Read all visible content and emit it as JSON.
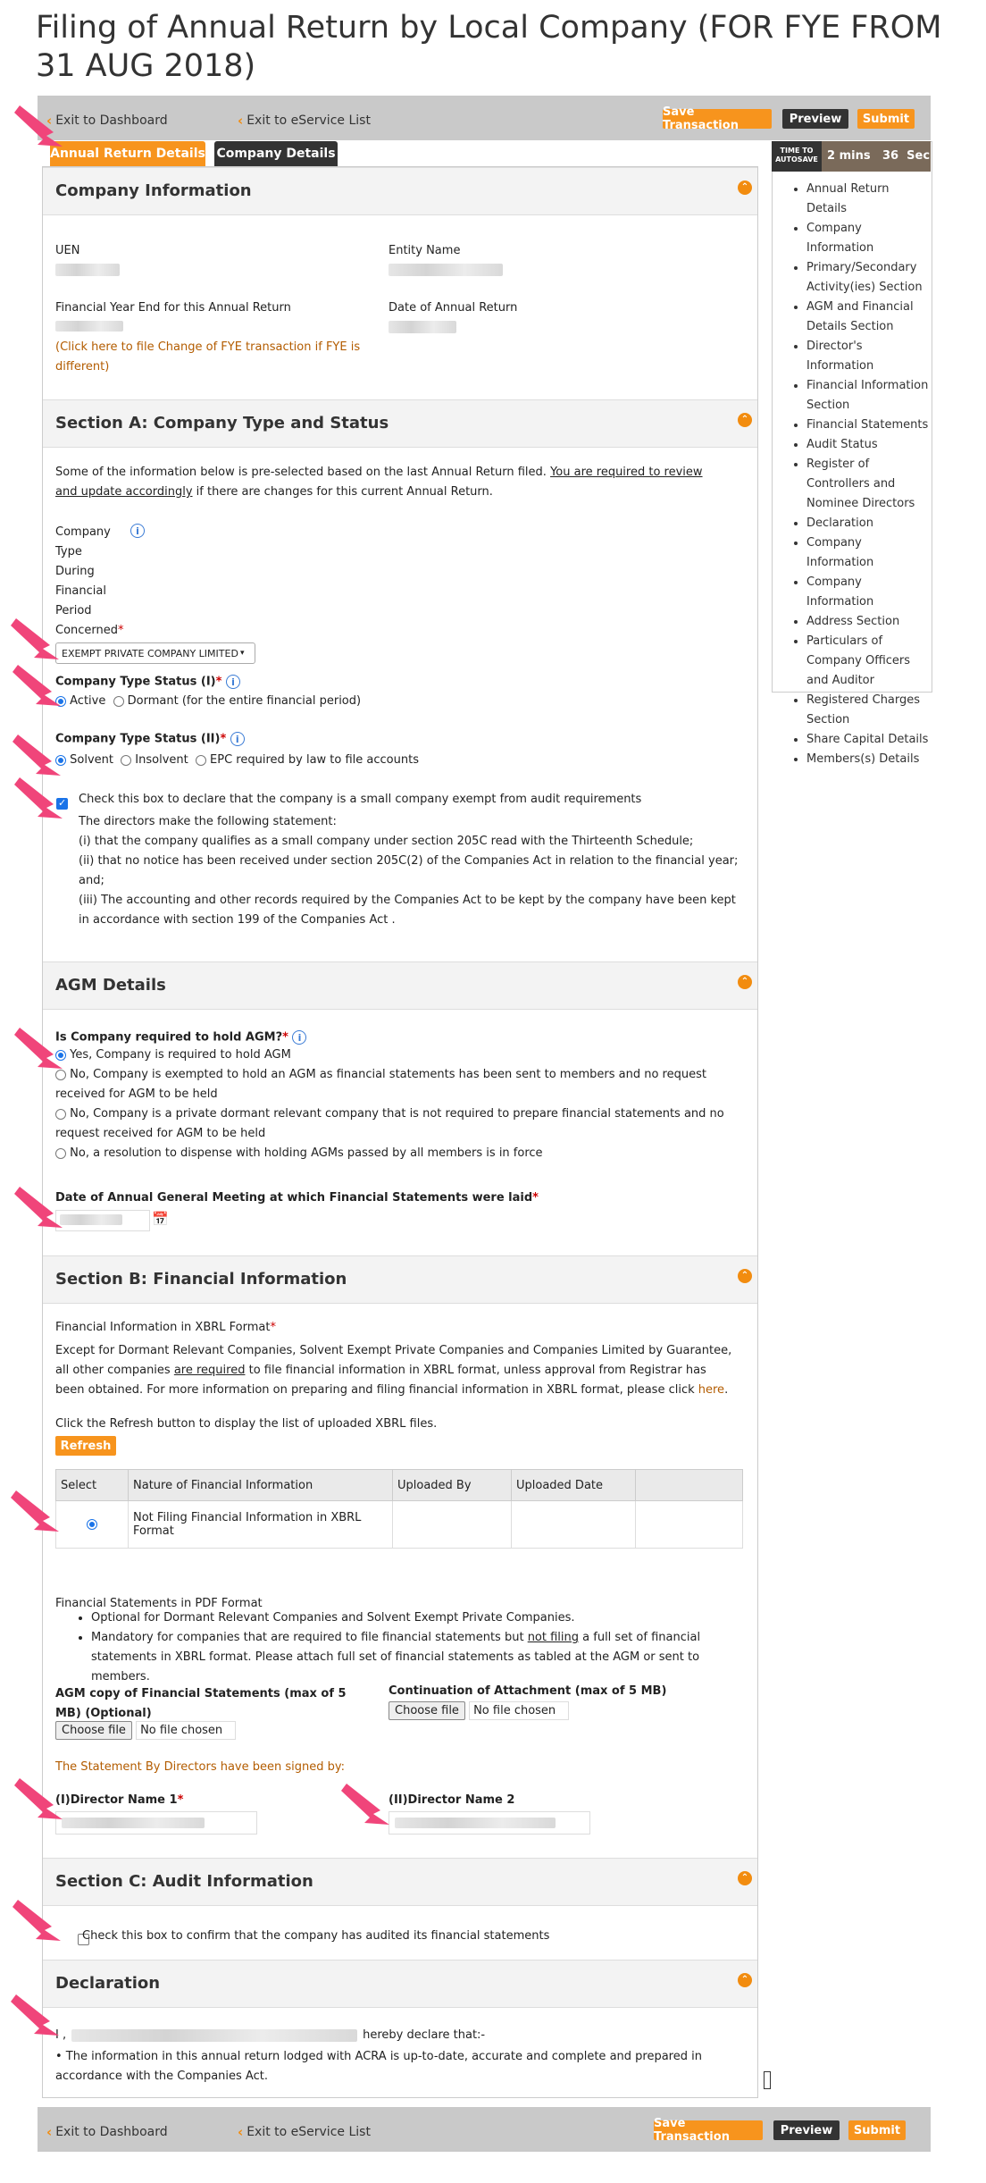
{
  "page_title": "Filing of Annual Return by Local Company (FOR FYE FROM 31 AUG 2018)",
  "toolbar": {
    "exit_dashboard": "Exit to Dashboard",
    "exit_eservice": "Exit to eService List",
    "save": "Save Transaction",
    "preview": "Preview",
    "submit": "Submit"
  },
  "tabs": [
    "Annual Return Details",
    "Company Details"
  ],
  "autosave": {
    "label": "TIME TO AUTOSAVE",
    "mins": "2 mins",
    "secs": "36  Sec"
  },
  "sidebar": [
    "Annual Return Details",
    "Company Information",
    "Primary/Secondary Activity(ies) Section",
    "AGM and Financial Details Section",
    "Director's Information",
    "Financial Information Section",
    "Financial Statements",
    "Audit Status",
    "Register of Controllers and Nominee Directors",
    "Declaration",
    "Company Information",
    "Company Information",
    "Address Section",
    "Particulars of Company Officers and Auditor",
    "Registered Charges Section",
    "Share Capital Details",
    "Members(s) Details"
  ],
  "company_info": {
    "heading": "Company Information",
    "uen_label": "UEN",
    "entity_label": "Entity Name",
    "fye_label": "Financial Year End for this Annual Return",
    "date_label": "Date of Annual Return",
    "fye_link": "(Click here to file Change of FYE transaction if FYE is different)"
  },
  "section_a": {
    "heading": "Section A: Company Type and Status",
    "intro_1": "Some of the information below is pre-selected based on the last Annual Return filed.",
    "intro_underline": "You are required to review and update accordingly",
    "intro_2": "if there are changes for this current Annual Return.",
    "company_type_label": "Company Type During Financial Period Concerned",
    "company_type_value": "EXEMPT PRIVATE COMPANY LIMITED",
    "status1_label": "Company Type Status (I)",
    "status1_options": [
      "Active",
      "Dormant (for the entire financial period)"
    ],
    "status2_label": "Company Type Status (II)",
    "status2_options": [
      "Solvent",
      "Insolvent",
      "EPC required by law to file accounts"
    ],
    "small_co_check": "Check this box to declare that the company is a small company exempt from audit requirements",
    "directors_stmt": "The directors make the following statement:",
    "stmt_1": "(i) that the company qualifies as a small company under section 205C read with the Thirteenth Schedule;",
    "stmt_2": "(ii) that no notice has been received under section 205C(2) of the Companies Act in relation to the financial year; and;",
    "stmt_3": "(iii) The accounting and other records required by the Companies Act to be kept by the company have been kept in accordance with section 199 of the Companies Act ."
  },
  "agm": {
    "heading": "AGM Details",
    "question": "Is Company required to hold AGM?",
    "options": [
      "Yes, Company is required to hold AGM",
      "No, Company is exempted to hold an AGM as financial statements has been sent to members and no request received for AGM to be held",
      "No, Company is a private dormant relevant company that is not required to prepare financial statements and no request received for AGM to be held",
      "No, a resolution to dispense with holding AGMs passed by all members is in force"
    ],
    "date_label": "Date of Annual General Meeting at which Financial Statements were laid"
  },
  "section_b": {
    "heading": "Section B: Financial Information",
    "xbrl_label": "Financial Information in XBRL Format",
    "xbrl_text_1": "Except for Dormant Relevant Companies, Solvent Exempt Private Companies and Companies Limited by Guarantee, all other companies",
    "xbrl_underline": "are required",
    "xbrl_text_2": "to file financial information in XBRL format, unless approval from Registrar has been obtained. For more information on preparing and filing financial information in XBRL format, please click",
    "here": "here",
    "refresh_hint": "Click the Refresh button to display the list of uploaded XBRL files.",
    "refresh": "Refresh",
    "table_headers": [
      "Select",
      "Nature of Financial Information",
      "Uploaded By",
      "Uploaded Date",
      ""
    ],
    "table_row": "Not Filing Financial Information in XBRL Format",
    "pdf_label": "Financial Statements in PDF Format",
    "bullet_1": "Optional for Dormant Relevant Companies and Solvent Exempt Private Companies.",
    "bullet_2a": "Mandatory for companies that are required to file financial statements but",
    "bullet_2u": "not filing",
    "bullet_2b": "a full set of financial statements in XBRL format. Please attach full set of financial statements as tabled at the AGM or sent to members.",
    "agm_copy_label": "AGM copy of Financial Statements (max of 5 MB) (Optional)",
    "continuation_label": "Continuation of Attachment (max of 5 MB)",
    "choose_file": "Choose file",
    "no_file": "No file chosen",
    "signed_by": "The Statement By Directors have been signed by:",
    "director1": "(I)Director Name 1",
    "director2": "(II)Director Name 2"
  },
  "section_c": {
    "heading": "Section C: Audit Information",
    "check": "Check this box to confirm that the company has audited its financial statements"
  },
  "declaration": {
    "heading": "Declaration",
    "prefix": "I ,",
    "suffix": "hereby declare that:-",
    "bullet": "• The information in this annual return lodged with ACRA is up-to-date, accurate and complete and prepared in accordance with the Companies Act."
  },
  "colors": {
    "accent": "#f7941d",
    "dark": "#333333",
    "arrow": "#f0457a"
  }
}
